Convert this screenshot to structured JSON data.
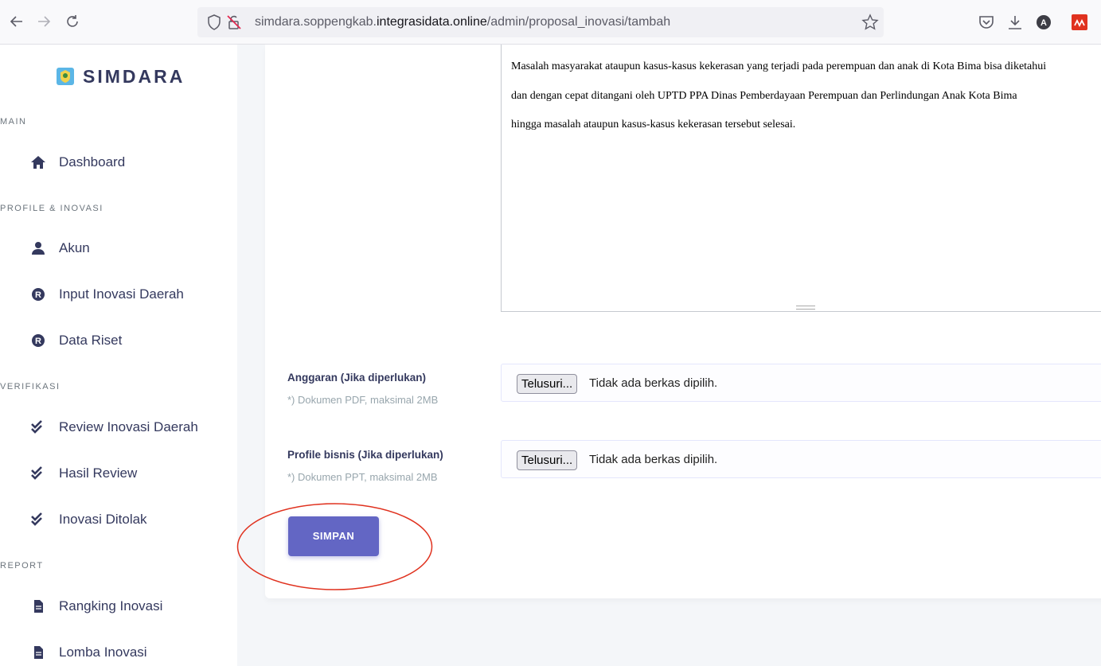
{
  "browser": {
    "url_prefix": "simdara.soppengkab.",
    "url_host": "integrasidata.online",
    "url_path": "/admin/proposal_inovasi/tambah",
    "toolbar_icons": [
      "back-arrow-icon",
      "forward-arrow-icon",
      "reload-icon",
      "shield-icon",
      "lock-insecure-icon",
      "star-icon",
      "pocket-icon",
      "download-icon",
      "account-icon",
      "extension-icon"
    ]
  },
  "sidebar": {
    "brand": "SIMDARA",
    "sections": [
      {
        "header": "MAIN",
        "items": [
          {
            "label": "Dashboard",
            "icon": "home-icon"
          }
        ]
      },
      {
        "header": "PROFILE & INOVASI",
        "items": [
          {
            "label": "Akun",
            "icon": "user-icon"
          },
          {
            "label": "Input Inovasi Daerah",
            "icon": "registered-icon"
          },
          {
            "label": "Data Riset",
            "icon": "registered-icon"
          }
        ]
      },
      {
        "header": "VERIFIKASI",
        "items": [
          {
            "label": "Review Inovasi Daerah",
            "icon": "check-double-icon"
          },
          {
            "label": "Hasil Review",
            "icon": "check-double-icon"
          },
          {
            "label": "Inovasi Ditolak",
            "icon": "check-double-icon"
          }
        ]
      },
      {
        "header": "REPORT",
        "items": [
          {
            "label": "Rangking Inovasi",
            "icon": "file-icon"
          },
          {
            "label": "Lomba Inovasi",
            "icon": "file-icon"
          }
        ]
      }
    ]
  },
  "form": {
    "textarea_lines": [
      "Masalah masyarakat ataupun kasus-kasus kekerasan yang terjadi pada perempuan dan anak di Kota Bima bisa diketahui",
      "dan dengan cepat ditangani oleh UPTD PPA Dinas Pemberdayaan Perempuan dan Perlindungan Anak Kota Bima",
      "hingga masalah ataupun kasus-kasus kekerasan tersebut selesai."
    ],
    "anggaran": {
      "label": "Anggaran (Jika diperlukan)",
      "hint": "*) Dokumen PDF, maksimal 2MB",
      "button": "Telusuri...",
      "status": "Tidak ada berkas dipilih."
    },
    "profile_bisnis": {
      "label": "Profile bisnis (Jika diperlukan)",
      "hint": "*) Dokumen PPT, maksimal 2MB",
      "button": "Telusuri...",
      "status": "Tidak ada berkas dipilih."
    },
    "save_button": "SIMPAN"
  },
  "colors": {
    "primary": "#6366c4",
    "annotation": "#e0321f"
  }
}
